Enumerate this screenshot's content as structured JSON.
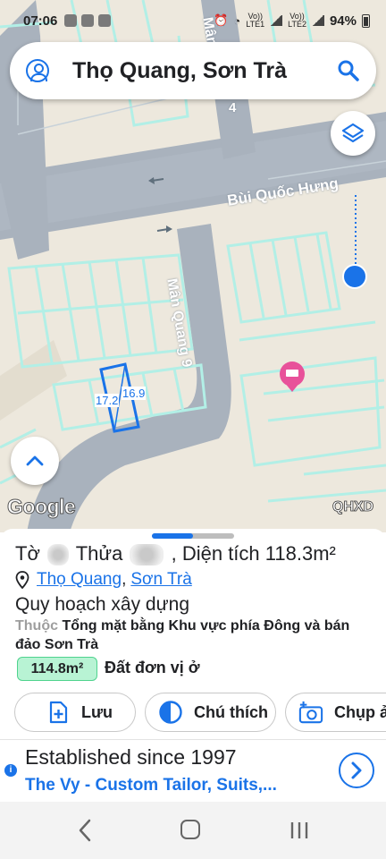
{
  "status_bar": {
    "time": "07:06",
    "net1": "Vo))\nLTE1",
    "net2": "Vo))\nLTE2",
    "battery": "94%"
  },
  "search": {
    "query": "Thọ Quang, Sơn Trà"
  },
  "map": {
    "street_1": "Bùi Quốc Hưng",
    "street_2": "Mân Quang 9",
    "street_3_top": "Mân",
    "street_3_num": "4",
    "parcel_edge_a": "17.2",
    "parcel_edge_b": "16.9",
    "logo": "Google",
    "layer_label": "QHXD"
  },
  "parcel": {
    "to_label": "Tờ",
    "thua_label": "Thửa",
    "area_label": ", Diện tích",
    "area_value": "118.3m²",
    "ward": "Thọ Quang",
    "separator": ",",
    "district": "Sơn Trà",
    "planning_title": "Quy hoạch xây dựng",
    "planning_prefix": "Thuộc",
    "planning_desc": "Tổng mặt bằng Khu vực phía Đông và bán đảo Sơn Trà",
    "zone_area": "114.8m²",
    "zone_type": "Đất đơn vị ở"
  },
  "actions": {
    "save": "Lưu",
    "legend": "Chú thích",
    "capture": "Chụp ả"
  },
  "ad": {
    "headline": "Established since 1997",
    "subline": "The Vy - Custom Tailor, Suits,..."
  },
  "colors": {
    "accent": "#1a73e8",
    "road": "#a9b2bd",
    "parcel_line": "#b2efe6",
    "land_bg": "#ede8dd",
    "zone_badge": "#b8f3d4"
  }
}
